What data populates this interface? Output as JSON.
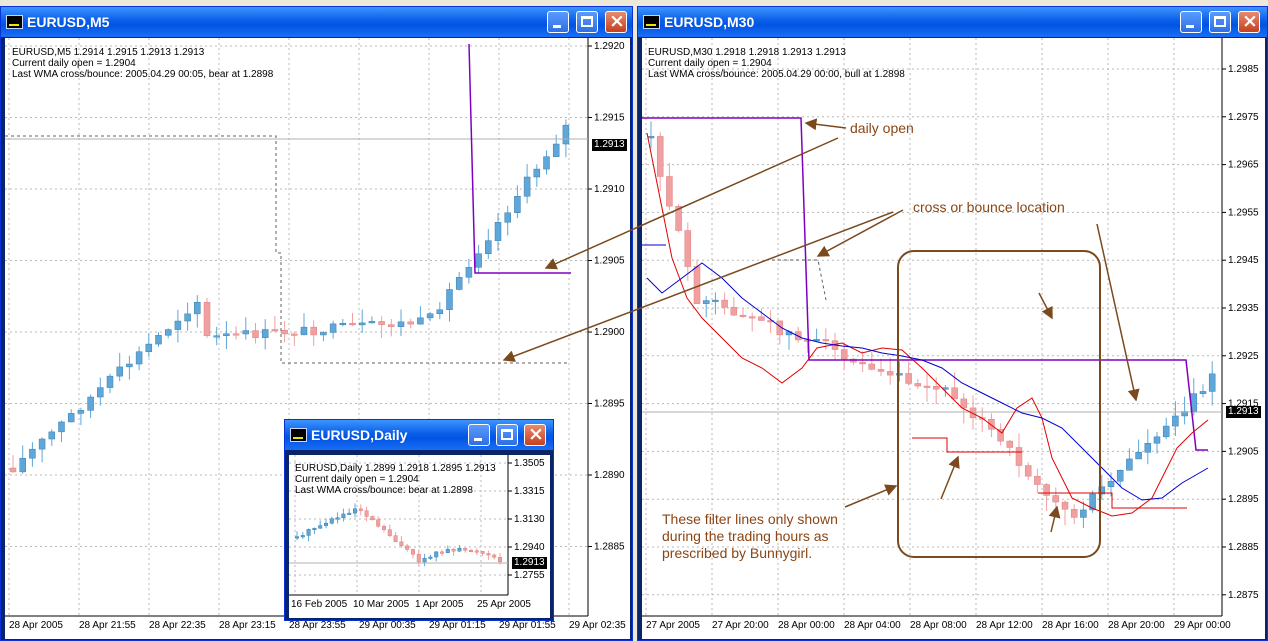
{
  "windows": {
    "m5": {
      "title": "EURUSD,M5",
      "info": [
        "EURUSD,M5  1.2914 1.2915 1.2913 1.2913",
        "Current daily open = 1.2904",
        "Last WMA cross/bounce: 2005.04.29 00:05, bear at 1.2898"
      ],
      "price_labels": [
        "1.2920",
        "1.2915",
        "1.2910",
        "1.2905",
        "1.2900",
        "1.2895",
        "1.2890",
        "1.2885"
      ],
      "last_price": "1.2913",
      "time_labels": [
        "28 Apr 2005",
        "28 Apr 21:55",
        "28 Apr 22:35",
        "28 Apr 23:15",
        "28 Apr 23:55",
        "29 Apr 00:35",
        "29 Apr 01:15",
        "29 Apr 01:55",
        "29 Apr 02:35"
      ]
    },
    "daily": {
      "title": "EURUSD,Daily",
      "info": [
        "EURUSD,Daily  1.2899 1.2918 1.2895 1.2913",
        "Current daily open = 1.2904",
        "Last WMA cross/bounce: bear at 1.2898"
      ],
      "price_labels": [
        "1.3505",
        "1.3315",
        "1.3130",
        "1.2940",
        "1.2755"
      ],
      "last_price": "1.2913",
      "time_labels": [
        "16 Feb 2005",
        "10 Mar 2005",
        "1 Apr 2005",
        "25 Apr 2005"
      ]
    },
    "m30": {
      "title": "EURUSD,M30",
      "info": [
        "EURUSD,M30  1.2918 1.2918 1.2913 1.2913",
        "Current daily open = 1.2904",
        "Last WMA cross/bounce: 2005.04.29 00:00, bull at 1.2898"
      ],
      "price_labels": [
        "1.2985",
        "1.2975",
        "1.2965",
        "1.2955",
        "1.2945",
        "1.2935",
        "1.2925",
        "1.2915",
        "1.2905",
        "1.2895",
        "1.2885",
        "1.2875"
      ],
      "last_price": "1.2913",
      "time_labels": [
        "27 Apr 2005",
        "27 Apr 20:00",
        "28 Apr 00:00",
        "28 Apr 04:00",
        "28 Apr 08:00",
        "28 Apr 12:00",
        "28 Apr 16:00",
        "28 Apr 20:00",
        "29 Apr 00:00"
      ]
    }
  },
  "annotations": {
    "daily_open": "daily open",
    "cross_bounce": "cross or bounce location",
    "filter_lines": [
      "These filter lines only shown",
      "during the trading hours as",
      "prescribed by Bunnygirl."
    ]
  },
  "colors": {
    "bull": "#5ea7d8",
    "bear": "#f0a0a0",
    "daily_open": "#8000c0",
    "wma_fast": "#e00000",
    "wma_slow": "#0000d0",
    "annotation": "#8b4513"
  }
}
